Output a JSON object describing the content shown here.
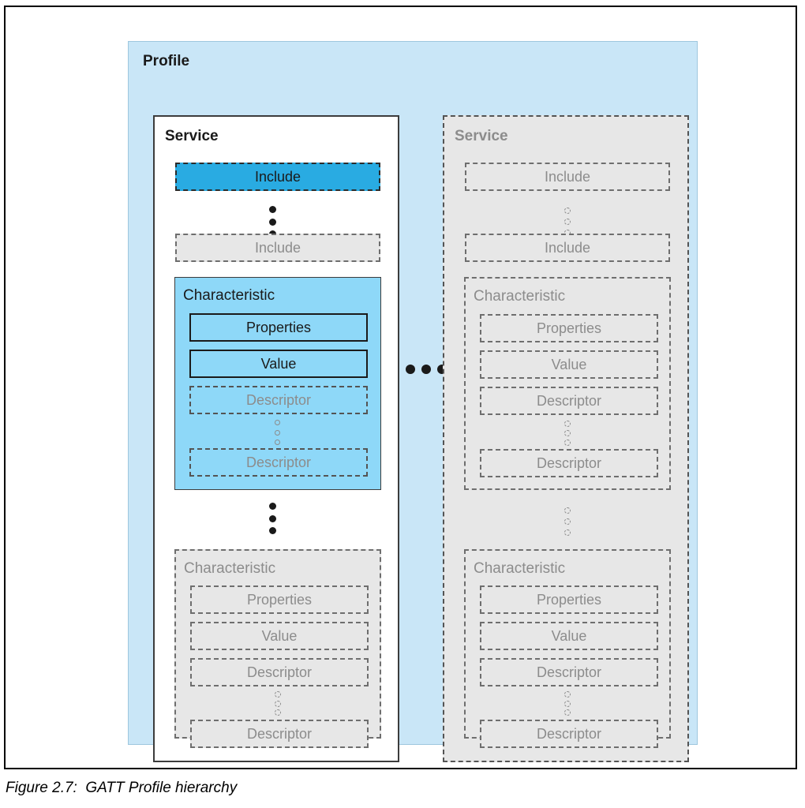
{
  "figure": {
    "caption": "Figure 2.7:  GATT Profile hierarchy"
  },
  "colors": {
    "profile_background": "#c9e6f7",
    "highlight_blue": "#29abe2",
    "characteristic_blue": "#8ed8f8",
    "ghost_grey_fill": "#e7e7e7",
    "ghost_grey_text": "#8c8c8c",
    "active_text": "#1a1a1a"
  },
  "diagram": {
    "type": "hierarchy",
    "profile": {
      "label": "Profile",
      "services": [
        {
          "id": "service-active",
          "label": "Service",
          "state": "active",
          "includes": [
            {
              "label": "Include",
              "state": "highlight"
            },
            {
              "label": "Include",
              "state": "ghost"
            }
          ],
          "include_ellipsis": "vertical-filled",
          "characteristics": [
            {
              "id": "characteristic-active",
              "label": "Characteristic",
              "state": "active",
              "fields": [
                {
                  "label": "Properties",
                  "state": "solid"
                },
                {
                  "label": "Value",
                  "state": "solid"
                }
              ],
              "descriptors": [
                {
                  "label": "Descriptor",
                  "state": "ghost-on-blue"
                },
                {
                  "label": "Descriptor",
                  "state": "ghost-on-blue"
                }
              ],
              "descriptor_ellipsis": "vertical-hollow"
            },
            {
              "id": "characteristic-ghost-left",
              "label": "Characteristic",
              "state": "ghost",
              "fields": [
                {
                  "label": "Properties",
                  "state": "ghost"
                },
                {
                  "label": "Value",
                  "state": "ghost"
                }
              ],
              "descriptors": [
                {
                  "label": "Descriptor",
                  "state": "ghost"
                },
                {
                  "label": "Descriptor",
                  "state": "ghost"
                }
              ],
              "descriptor_ellipsis": "vertical-hollow"
            }
          ],
          "characteristic_ellipsis": "vertical-filled"
        },
        {
          "id": "service-ghost",
          "label": "Service",
          "state": "ghost",
          "includes": [
            {
              "label": "Include",
              "state": "ghost"
            },
            {
              "label": "Include",
              "state": "ghost"
            }
          ],
          "include_ellipsis": "vertical-hollow",
          "characteristics": [
            {
              "id": "characteristic-ghost-right-top",
              "label": "Characteristic",
              "state": "ghost",
              "fields": [
                {
                  "label": "Properties",
                  "state": "ghost"
                },
                {
                  "label": "Value",
                  "state": "ghost"
                }
              ],
              "descriptors": [
                {
                  "label": "Descriptor",
                  "state": "ghost"
                },
                {
                  "label": "Descriptor",
                  "state": "ghost"
                }
              ],
              "descriptor_ellipsis": "vertical-hollow"
            },
            {
              "id": "characteristic-ghost-right-bottom",
              "label": "Characteristic",
              "state": "ghost",
              "fields": [
                {
                  "label": "Properties",
                  "state": "ghost"
                },
                {
                  "label": "Value",
                  "state": "ghost"
                }
              ],
              "descriptors": [
                {
                  "label": "Descriptor",
                  "state": "ghost"
                },
                {
                  "label": "Descriptor",
                  "state": "ghost"
                }
              ],
              "descriptor_ellipsis": "vertical-hollow"
            }
          ],
          "characteristic_ellipsis": "vertical-hollow"
        }
      ],
      "service_ellipsis": "horizontal-filled"
    }
  }
}
